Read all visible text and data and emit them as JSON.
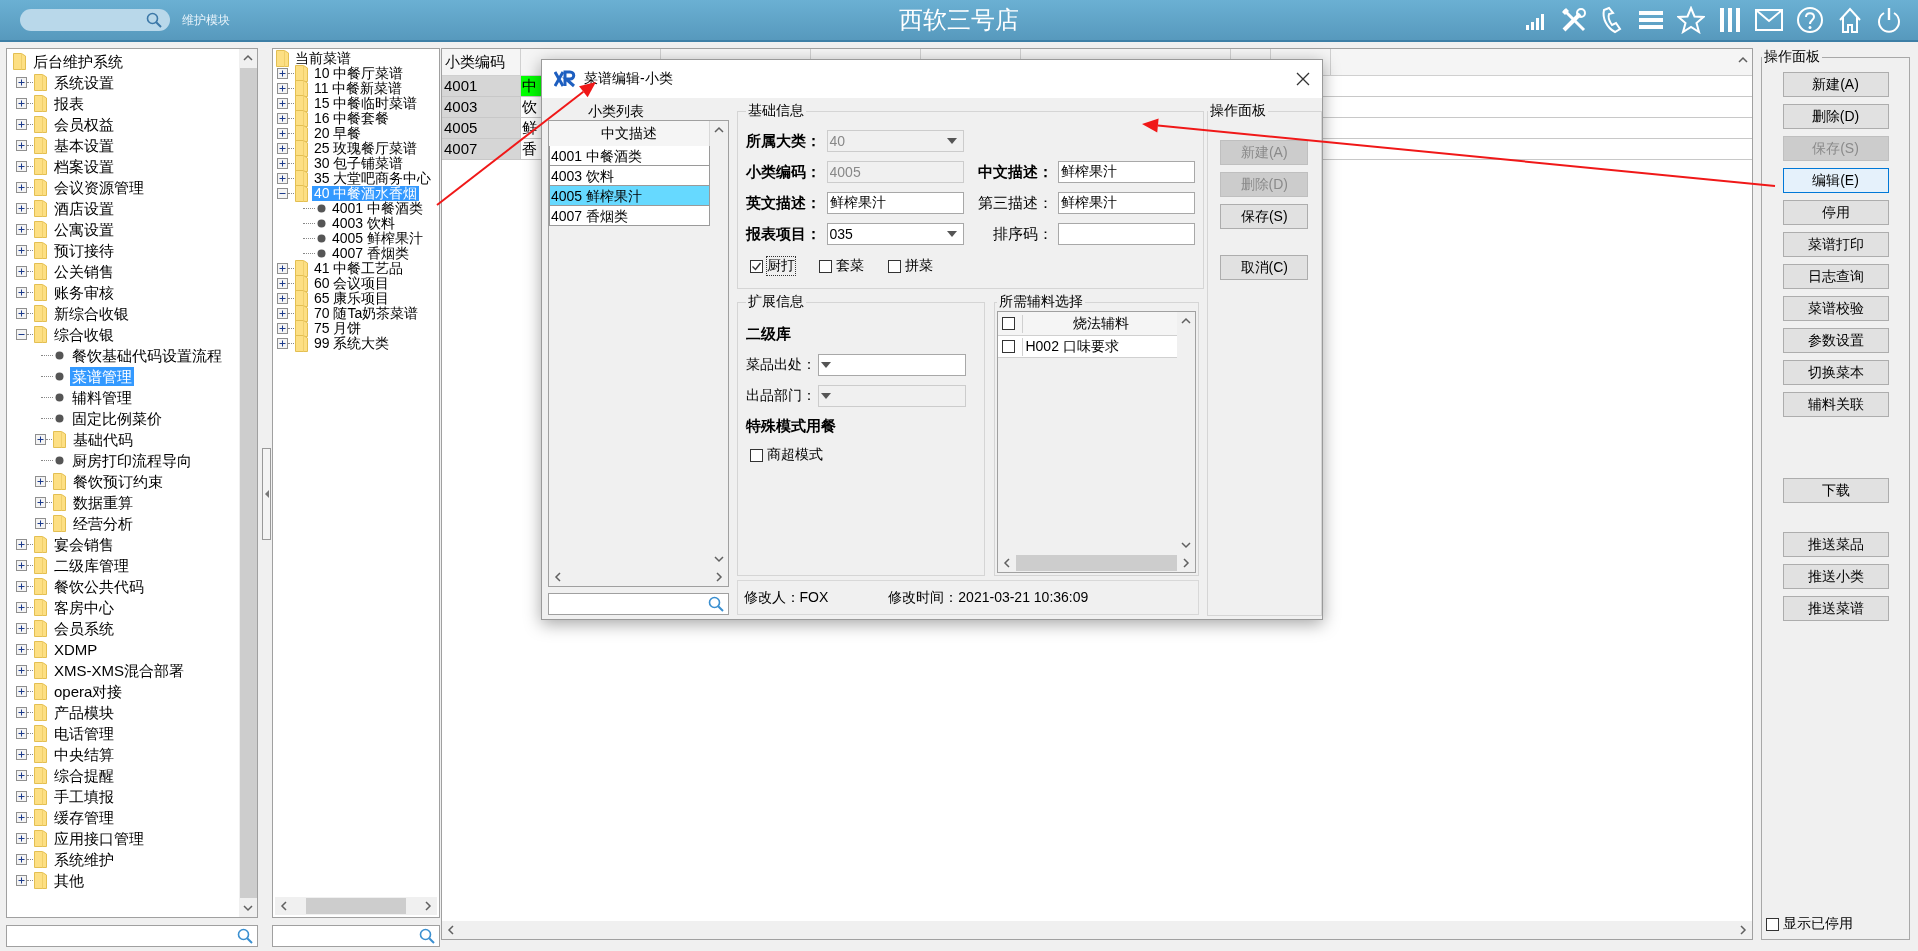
{
  "topbar": {
    "module_label": "维护模块",
    "title": "西软三号店"
  },
  "left_tree": {
    "items": [
      {
        "label": "后台维护系统",
        "kind": "root",
        "selected": false,
        "children": [
          {
            "label": "系统设置",
            "kind": "folder",
            "expanded": false,
            "selected": false
          },
          {
            "label": "报表",
            "kind": "folder",
            "expanded": false,
            "selected": false
          },
          {
            "label": "会员权益",
            "kind": "folder",
            "expanded": false,
            "selected": false
          },
          {
            "label": "基本设置",
            "kind": "folder",
            "expanded": false,
            "selected": false
          },
          {
            "label": "档案设置",
            "kind": "folder",
            "expanded": false,
            "selected": false
          },
          {
            "label": "会议资源管理",
            "kind": "folder",
            "expanded": false,
            "selected": false
          },
          {
            "label": "酒店设置",
            "kind": "folder",
            "expanded": false,
            "selected": false
          },
          {
            "label": "公寓设置",
            "kind": "folder",
            "expanded": false,
            "selected": false
          },
          {
            "label": "预订接待",
            "kind": "folder",
            "expanded": false,
            "selected": false
          },
          {
            "label": "公关销售",
            "kind": "folder",
            "expanded": false,
            "selected": false
          },
          {
            "label": "账务审核",
            "kind": "folder",
            "expanded": false,
            "selected": false
          },
          {
            "label": "新综合收银",
            "kind": "folder",
            "expanded": false,
            "selected": false
          },
          {
            "label": "综合收银",
            "kind": "folder",
            "expanded": true,
            "selected": false,
            "children": [
              {
                "label": "餐饮基础代码设置流程",
                "kind": "leaf",
                "selected": false
              },
              {
                "label": "菜谱管理",
                "kind": "leaf",
                "selected": true
              },
              {
                "label": "辅料管理",
                "kind": "leaf",
                "selected": false
              },
              {
                "label": "固定比例菜价",
                "kind": "leaf",
                "selected": false
              },
              {
                "label": "基础代码",
                "kind": "folder",
                "expanded": false,
                "selected": false
              },
              {
                "label": "厨房打印流程导向",
                "kind": "leaf",
                "selected": false
              },
              {
                "label": "餐饮预订约束",
                "kind": "folder",
                "expanded": false,
                "selected": false
              },
              {
                "label": "数据重算",
                "kind": "folder",
                "expanded": false,
                "selected": false
              },
              {
                "label": "经营分析",
                "kind": "folder",
                "expanded": false,
                "selected": false
              }
            ]
          },
          {
            "label": "宴会销售",
            "kind": "folder",
            "expanded": false,
            "selected": false
          },
          {
            "label": "二级库管理",
            "kind": "folder",
            "expanded": false,
            "selected": false
          },
          {
            "label": "餐饮公共代码",
            "kind": "folder",
            "expanded": false,
            "selected": false
          },
          {
            "label": "客房中心",
            "kind": "folder",
            "expanded": false,
            "selected": false
          },
          {
            "label": "会员系统",
            "kind": "folder",
            "expanded": false,
            "selected": false
          },
          {
            "label": "XDMP",
            "kind": "folder",
            "expanded": false,
            "selected": false
          },
          {
            "label": "XMS-XMS混合部署",
            "kind": "folder",
            "expanded": false,
            "selected": false
          },
          {
            "label": "opera对接",
            "kind": "folder",
            "expanded": false,
            "selected": false
          },
          {
            "label": "产品模块",
            "kind": "folder",
            "expanded": false,
            "selected": false
          },
          {
            "label": "电话管理",
            "kind": "folder",
            "expanded": false,
            "selected": false
          },
          {
            "label": "中央结算",
            "kind": "folder",
            "expanded": false,
            "selected": false
          },
          {
            "label": "综合提醒",
            "kind": "folder",
            "expanded": false,
            "selected": false
          },
          {
            "label": "手工填报",
            "kind": "folder",
            "expanded": false,
            "selected": false
          },
          {
            "label": "缓存管理",
            "kind": "folder",
            "expanded": false,
            "selected": false
          },
          {
            "label": "应用接口管理",
            "kind": "folder",
            "expanded": false,
            "selected": false
          },
          {
            "label": "系统维护",
            "kind": "folder",
            "expanded": false,
            "selected": false
          },
          {
            "label": "其他",
            "kind": "folder",
            "expanded": false,
            "selected": false
          }
        ]
      }
    ]
  },
  "menu_tree": {
    "items": [
      {
        "label": "当前菜谱",
        "kind": "root",
        "selected": false,
        "children": [
          {
            "label": "10 中餐厅菜谱",
            "kind": "folder",
            "expanded": false,
            "selected": false
          },
          {
            "label": "11 中餐新菜谱",
            "kind": "folder",
            "expanded": false,
            "selected": false
          },
          {
            "label": "15 中餐临时菜谱",
            "kind": "folder",
            "expanded": false,
            "selected": false
          },
          {
            "label": "16 中餐套餐",
            "kind": "folder",
            "expanded": false,
            "selected": false
          },
          {
            "label": "20 早餐",
            "kind": "folder",
            "expanded": false,
            "selected": false
          },
          {
            "label": "25 玫瑰餐厅菜谱",
            "kind": "folder",
            "expanded": false,
            "selected": false
          },
          {
            "label": "30 包子铺菜谱",
            "kind": "folder",
            "expanded": false,
            "selected": false
          },
          {
            "label": "35 大堂吧商务中心",
            "kind": "folder",
            "expanded": false,
            "selected": false
          },
          {
            "label": "40 中餐酒水香烟",
            "kind": "folder",
            "expanded": true,
            "selected": true,
            "children": [
              {
                "label": "4001 中餐酒类",
                "kind": "leaf",
                "selected": false
              },
              {
                "label": "4003 饮料",
                "kind": "leaf",
                "selected": false
              },
              {
                "label": "4005 鲜榨果汁",
                "kind": "leaf",
                "selected": false
              },
              {
                "label": "4007 香烟类",
                "kind": "leaf",
                "selected": false
              }
            ]
          },
          {
            "label": "41 中餐工艺品",
            "kind": "folder",
            "expanded": false,
            "selected": false
          },
          {
            "label": "60 会议项目",
            "kind": "folder",
            "expanded": false,
            "selected": false
          },
          {
            "label": "65 康乐项目",
            "kind": "folder",
            "expanded": false,
            "selected": false
          },
          {
            "label": "70 随Ta奶茶菜谱",
            "kind": "folder",
            "expanded": false,
            "selected": false
          },
          {
            "label": "75 月饼",
            "kind": "folder",
            "expanded": false,
            "selected": false
          },
          {
            "label": "99 系统大类",
            "kind": "folder",
            "expanded": false,
            "selected": false
          }
        ]
      }
    ]
  },
  "table": {
    "columns": [
      "小类编码"
    ],
    "rows": [
      {
        "code": "4001",
        "column_2": "中",
        "current": true
      },
      {
        "code": "4003",
        "column_2": "饮",
        "current": false
      },
      {
        "code": "4005",
        "column_2": "鲜",
        "current": false
      },
      {
        "code": "4007",
        "column_2": "香",
        "current": false
      }
    ]
  },
  "right_panel": {
    "title": "操作面板",
    "button_groups": [
      [
        {
          "label": "新建(A)",
          "disabled": false,
          "focused": false
        },
        {
          "label": "删除(D)",
          "disabled": false,
          "focused": false
        },
        {
          "label": "保存(S)",
          "disabled": true,
          "focused": false
        },
        {
          "label": "编辑(E)",
          "disabled": false,
          "focused": true
        },
        {
          "label": "停用",
          "disabled": false,
          "focused": false
        },
        {
          "label": "菜谱打印",
          "disabled": false,
          "focused": false
        },
        {
          "label": "日志查询",
          "disabled": false,
          "focused": false
        },
        {
          "label": "菜谱校验",
          "disabled": false,
          "focused": false
        },
        {
          "label": "参数设置",
          "disabled": false,
          "focused": false
        },
        {
          "label": "切换菜本",
          "disabled": false,
          "focused": false
        },
        {
          "label": "辅料关联",
          "disabled": false,
          "focused": false
        }
      ],
      [
        {
          "label": "下载",
          "disabled": false,
          "focused": false
        }
      ],
      [
        {
          "label": "推送菜品",
          "disabled": false,
          "focused": false
        },
        {
          "label": "推送小类",
          "disabled": false,
          "focused": false
        },
        {
          "label": "推送菜谱",
          "disabled": false,
          "focused": false
        }
      ]
    ],
    "show_disabled": {
      "label": "显示已停用",
      "checked": false
    }
  },
  "dialog": {
    "title": "菜谱编辑-小类",
    "list": {
      "title": "小类列表",
      "header": "中文描述",
      "rows": [
        {
          "code": "4001",
          "name": "中餐酒类",
          "selected": false
        },
        {
          "code": "4003",
          "name": "饮料",
          "selected": false
        },
        {
          "code": "4005",
          "name": "鲜榨果汁",
          "selected": true
        },
        {
          "code": "4007",
          "name": "香烟类",
          "selected": false
        }
      ]
    },
    "basic": {
      "title": "基础信息",
      "rows": [
        [
          {
            "label": "所属大类：",
            "value": "40",
            "kind": "combo",
            "required": true,
            "disabled": true
          }
        ],
        [
          {
            "label": "小类编码：",
            "value": "4005",
            "kind": "text",
            "required": true,
            "disabled": true
          },
          {
            "label": "中文描述：",
            "value": "鲜榨果汁",
            "kind": "text",
            "required": true,
            "disabled": false
          }
        ],
        [
          {
            "label": "英文描述：",
            "value": "鲜榨果汁",
            "kind": "text",
            "required": true,
            "disabled": false
          },
          {
            "label": "第三描述：",
            "value": "鲜榨果汁",
            "kind": "text",
            "required": false,
            "disabled": false
          }
        ],
        [
          {
            "label": "报表项目：",
            "value": "035",
            "kind": "combo",
            "required": true,
            "disabled": false
          },
          {
            "label": "排序码：",
            "kind": "text",
            "required": false,
            "disabled": false
          }
        ]
      ],
      "checks": [
        {
          "label": "厨打",
          "checked": true,
          "focused": true
        },
        {
          "label": "套菜",
          "checked": false,
          "focused": false
        },
        {
          "label": "拼菜",
          "checked": false,
          "focused": false
        }
      ]
    },
    "ext": {
      "title": "扩展信息",
      "sections": [
        {
          "heading": "二级库",
          "fields": [
            {
              "label": "菜品出处：",
              "kind": "combo",
              "disabled": false
            },
            {
              "label": "出品部门：",
              "kind": "combo",
              "disabled": true
            }
          ]
        },
        {
          "heading": "特殊模式用餐",
          "checks": [
            {
              "label": "商超模式",
              "checked": false
            }
          ]
        }
      ]
    },
    "aux": {
      "title": "所需辅料选择",
      "header": "烧法辅料",
      "header_checked": false,
      "rows": [
        {
          "label": "H002 口味要求",
          "checked": false
        }
      ]
    },
    "ops": {
      "title": "操作面板",
      "button_groups": [
        [
          {
            "label": "新建(A)",
            "disabled": true
          },
          {
            "label": "删除(D)",
            "disabled": true
          },
          {
            "label": "保存(S)",
            "disabled": false
          }
        ],
        [
          {
            "label": "取消(C)",
            "disabled": false
          }
        ]
      ]
    },
    "footer": {
      "modifier": "修改人：FOX",
      "modified_time": "修改时间：2021-03-21 10:36:09"
    }
  }
}
